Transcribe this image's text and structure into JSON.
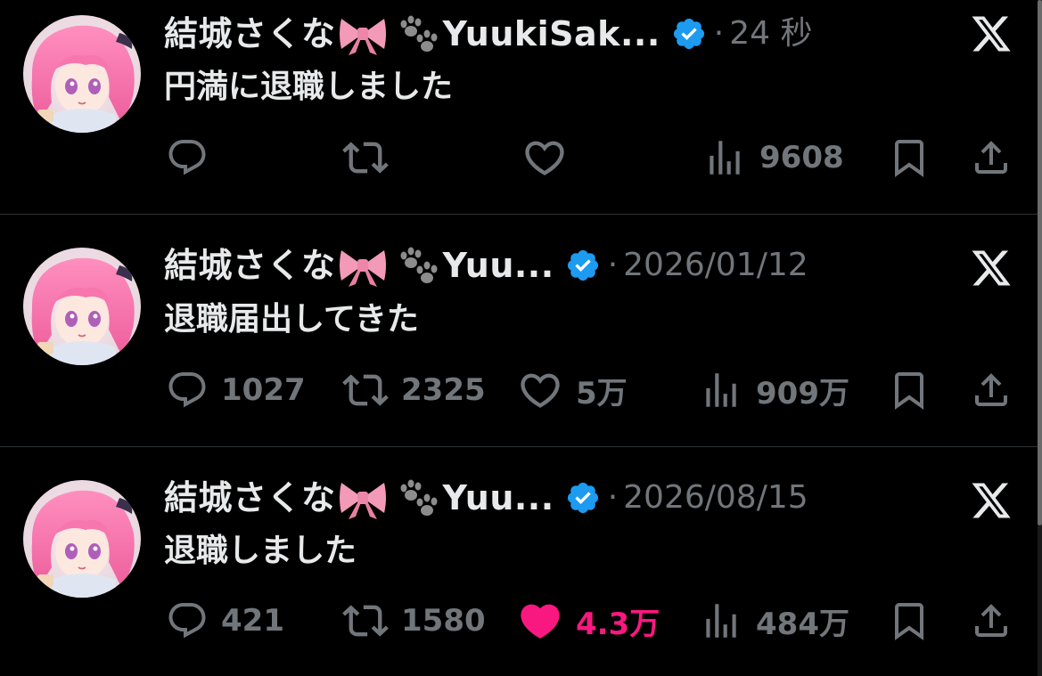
{
  "colors": {
    "background": "#000000",
    "text_primary": "#e7e9ea",
    "text_secondary": "#71767b",
    "verified_blue": "#1d9bf0",
    "like_pink": "#f91880",
    "divider": "#2f3336"
  },
  "posts": [
    {
      "author_name": "結城さくな",
      "author_name_suffix": "YuukiSak...",
      "name_emojis": [
        "ribbon",
        "paw-prints"
      ],
      "verified": true,
      "separator": "·",
      "time": "24 秒",
      "text": "円満に退職しました",
      "reply_count": "",
      "retweet_count": "",
      "like_count": "",
      "liked": false,
      "view_count": "9608",
      "platform_logo": "x-logo"
    },
    {
      "author_name": "結城さくな",
      "author_name_suffix": "Yuu...",
      "name_emojis": [
        "ribbon",
        "paw-prints"
      ],
      "verified": true,
      "separator": "·",
      "time": "2026/01/12",
      "text": "退職届出してきた",
      "reply_count": "1027",
      "retweet_count": "2325",
      "like_count": "5万",
      "liked": false,
      "view_count": "909万",
      "platform_logo": "x-logo"
    },
    {
      "author_name": "結城さくな",
      "author_name_suffix": "Yuu...",
      "name_emojis": [
        "ribbon",
        "paw-prints"
      ],
      "verified": true,
      "separator": "·",
      "time": "2026/08/15",
      "text": "退職しました",
      "reply_count": "421",
      "retweet_count": "1580",
      "like_count": "4.3万",
      "liked": true,
      "view_count": "484万",
      "platform_logo": "x-logo"
    }
  ]
}
